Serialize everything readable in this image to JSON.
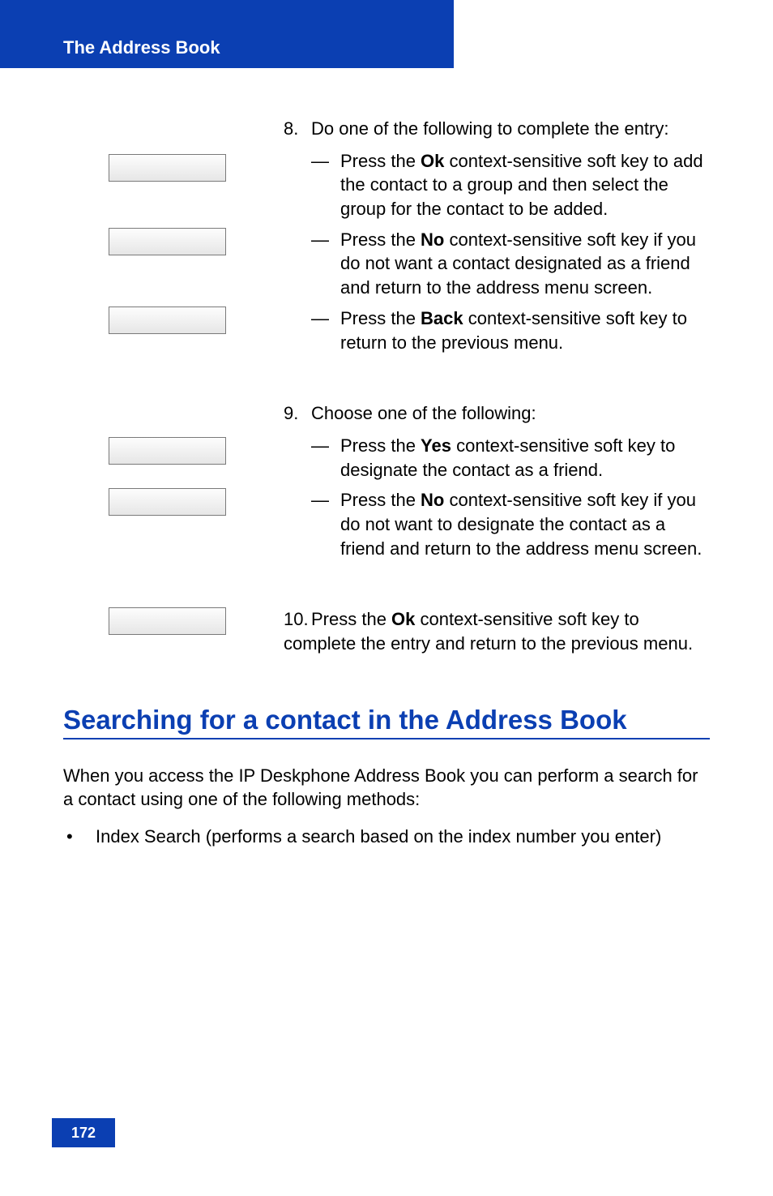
{
  "header": {
    "section": "The Address Book"
  },
  "step8": {
    "num": "8.",
    "lead": "Do one of the following to complete the entry:",
    "items": [
      {
        "pre": "Press the ",
        "mid": "Ok",
        "post": " context-sensitive soft key to add the contact to a group and then select the group for the contact to be added."
      },
      {
        "pre": "Press the ",
        "mid": "No",
        "post": " context-sensitive soft key if you do not want a contact designated as a friend and return to the address menu screen."
      },
      {
        "pre": "Press the ",
        "mid": "Back",
        "post": " context-sensitive soft key to return to the previous menu."
      }
    ]
  },
  "step9": {
    "num": "9.",
    "lead": "Choose one of the following:",
    "items": [
      {
        "pre": "Press the ",
        "mid": "Yes",
        "post": " context-sensitive soft key to designate the contact as a friend."
      },
      {
        "pre": "Press the ",
        "mid": "No",
        "post": " context-sensitive soft key if you do not want to designate the contact as a friend and return to the address menu screen."
      }
    ]
  },
  "step10": {
    "num": "10.",
    "pre": "Press the ",
    "mid": "Ok",
    "post": " context-sensitive soft key to complete the entry and return to the previous menu."
  },
  "heading": "Searching for a contact in the Address Book",
  "para": "When you access the IP Deskphone Address Book you can perform a search for a contact using one of the following methods:",
  "bullet1": "Index Search (performs a search based on the index number you enter)",
  "pageNum": "172"
}
